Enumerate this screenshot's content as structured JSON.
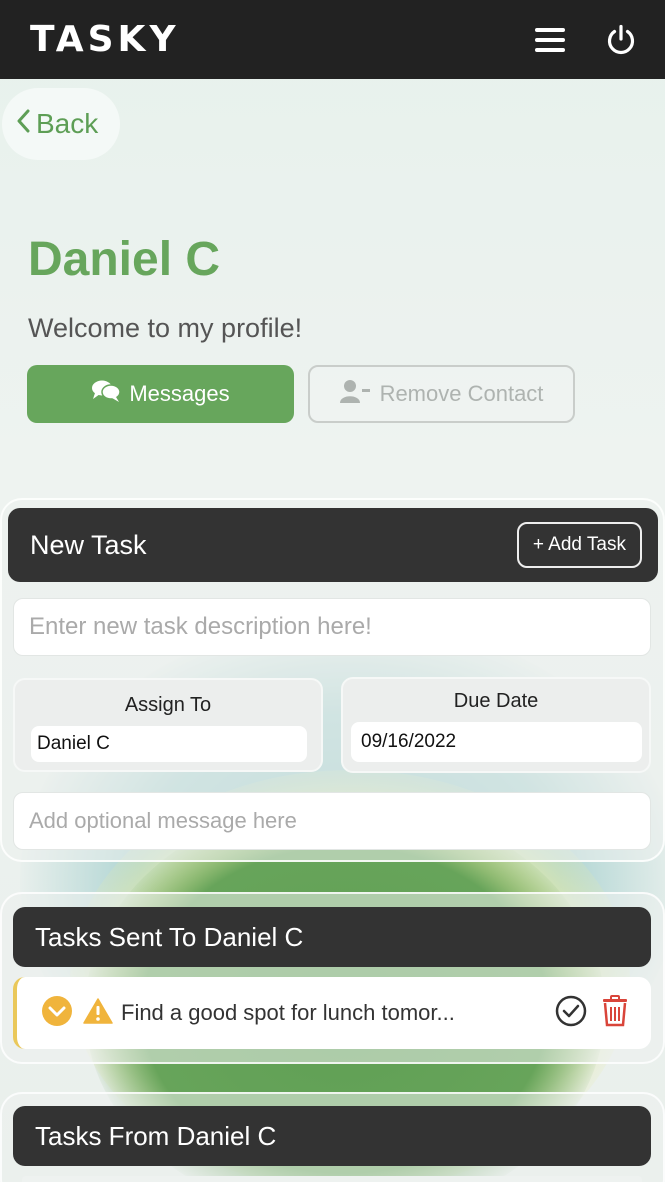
{
  "header": {
    "logo": "TASKY",
    "menu_icon": "hamburger-menu-icon",
    "power_icon": "power-icon"
  },
  "nav": {
    "back_label": "Back"
  },
  "profile": {
    "name": "Daniel C",
    "subtitle": "Welcome to my profile!"
  },
  "actions": {
    "messages_label": "Messages",
    "remove_contact_label": "Remove Contact"
  },
  "new_task": {
    "title": "New Task",
    "add_button": "+ Add Task",
    "description_placeholder": "Enter new task description here!",
    "assign_label": "Assign To",
    "assign_value": "Daniel C",
    "due_label": "Due Date",
    "due_value": "09/16/2022",
    "message_placeholder": "Add optional message here"
  },
  "sent_tasks": {
    "title": "Tasks Sent To Daniel C",
    "items": [
      {
        "text": "Find a good spot for lunch tomor..."
      }
    ]
  },
  "from_tasks": {
    "title": "Tasks From Daniel C"
  },
  "colors": {
    "brand_green": "#67a65c",
    "dark": "#333333",
    "warning": "#f0b43c",
    "delete": "#d9453a"
  }
}
